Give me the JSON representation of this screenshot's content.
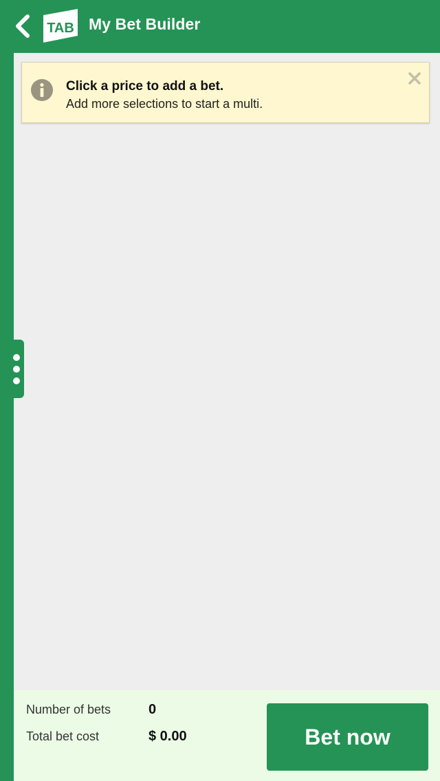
{
  "header": {
    "title": "My Bet Builder",
    "logo_text": "TAB",
    "back_icon": "chevron-left-icon"
  },
  "banner": {
    "icon": "info-icon",
    "title": "Click a price to add a bet.",
    "text": "Add more selections to start a multi.",
    "close_icon": "close-icon"
  },
  "side_handle": {
    "icon": "vertical-dots-icon"
  },
  "footer": {
    "number_of_bets_label": "Number of bets",
    "number_of_bets_value": "0",
    "total_cost_label": "Total bet cost",
    "total_cost_value": "$ 0.00",
    "bet_now_label": "Bet now"
  },
  "colors": {
    "brand_green": "#249355",
    "panel_bg": "#eeeeee",
    "banner_bg": "#fef7cf",
    "footer_bg": "#ecfbe6"
  }
}
